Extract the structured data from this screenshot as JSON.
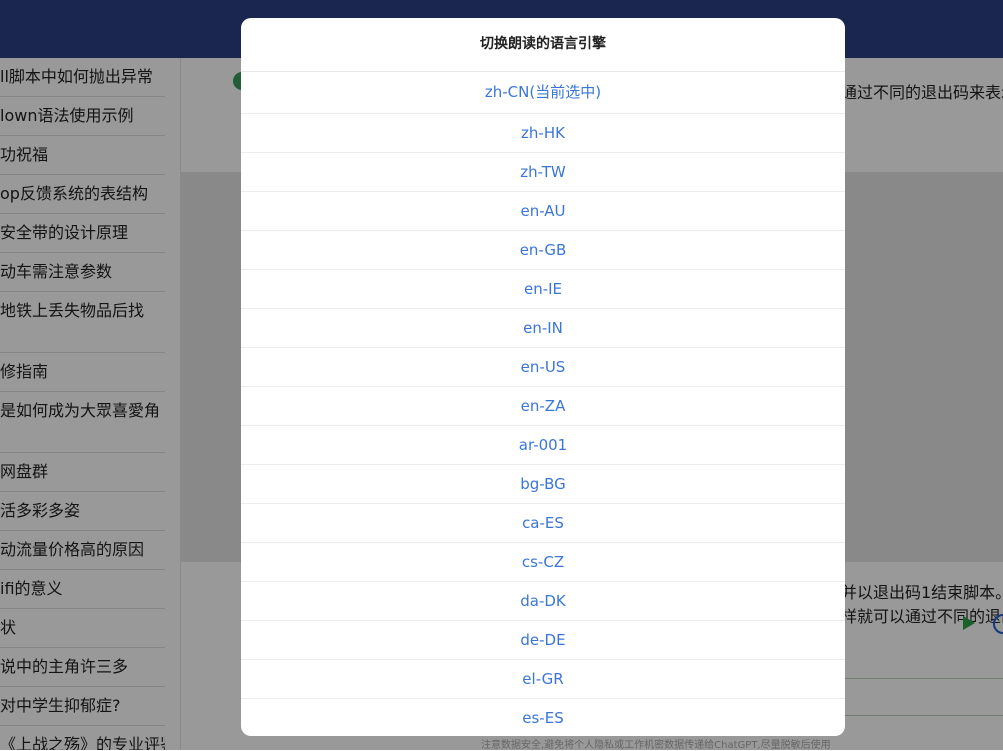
{
  "sidebar": {
    "items": [
      "ll脚本中如何抛出异常",
      "lown语法使用示例",
      "功祝福",
      "op反馈系统的表结构",
      "安全带的设计原理",
      "动车需注意参数",
      "地铁上丢失物品后找",
      "修指南",
      "是如何成为大眾喜愛角",
      "网盘群",
      "活多彩多姿",
      "动流量价格高的原因",
      "ifi的意义",
      "状",
      "说中的主角许三多",
      "对中学生抑郁症?",
      "《上战之殇》的专业评鉴"
    ]
  },
  "main": {
    "top_text": "通过不同的退出码来表示",
    "answer_line1": "并以退出码1结束脚本。",
    "answer_line2": "样就可以通过不同的退出",
    "footer_note": "注意数据安全,避免将个人隐私或工作机密数据传递给ChatGPT,尽量脱敏后使用"
  },
  "modal": {
    "title": "切换朗读的语言引擎",
    "languages": [
      "zh-CN(当前选中)",
      "zh-HK",
      "zh-TW",
      "en-AU",
      "en-GB",
      "en-IE",
      "en-IN",
      "en-US",
      "en-ZA",
      "ar-001",
      "bg-BG",
      "ca-ES",
      "cs-CZ",
      "da-DK",
      "de-DE",
      "el-GR",
      "es-ES"
    ]
  }
}
